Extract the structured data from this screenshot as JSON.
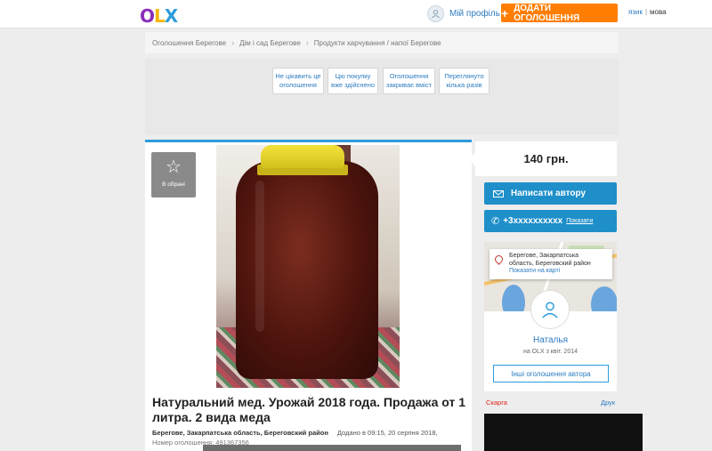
{
  "header": {
    "logo": {
      "o": "O",
      "l": "L",
      "x": "X"
    },
    "profile_label": "Мій профіль",
    "add_button": "ДОДАТИ ОГОЛОШЕННЯ",
    "lang_ru": "язик",
    "lang_ua": "мова"
  },
  "breadcrumb": [
    "Оголошення Берегове",
    "Дім і сад Берегове",
    "Продукти харчування / напої Берегове"
  ],
  "reasons": [
    {
      "line1": "Не цікавить це",
      "line2": "оголошення"
    },
    {
      "line1": "Цю покупку",
      "line2": "вже здійснено"
    },
    {
      "line1": "Оголошення",
      "line2": "закриває вміст"
    },
    {
      "line1": "Переглянуто",
      "line2": "кілька разів"
    }
  ],
  "listing": {
    "favorite_label": "В обрані",
    "title": "Натуральний мед. Урожай 2018 года. Продажа от 1 литра. 2 вида меда",
    "location": "Берегове, Закарпатська область, Береговский район",
    "added": "Додано в 09:15, 20 серпня 2018,",
    "ad_number": "Номер оголошення: 491367356"
  },
  "sidebar": {
    "price": "140 грн.",
    "write_button": "Написати автору",
    "phone": "+3xxxxxxxxxx",
    "show_phone": "Показати",
    "address_line1": "Берегове, Закарпатська",
    "address_line2": "область, Береговский район",
    "map_link": "Показати на карті",
    "user_name": "Наталья",
    "user_since": "на OLX з квіт. 2014",
    "other_ads": "Інші оголошення автора",
    "complain": "Скарга",
    "print": "Друк"
  },
  "colors": {
    "accent": "#ff7d00",
    "link": "#2d7cc0",
    "primary_button": "#1f8fc9",
    "complain": "#e2231a"
  }
}
